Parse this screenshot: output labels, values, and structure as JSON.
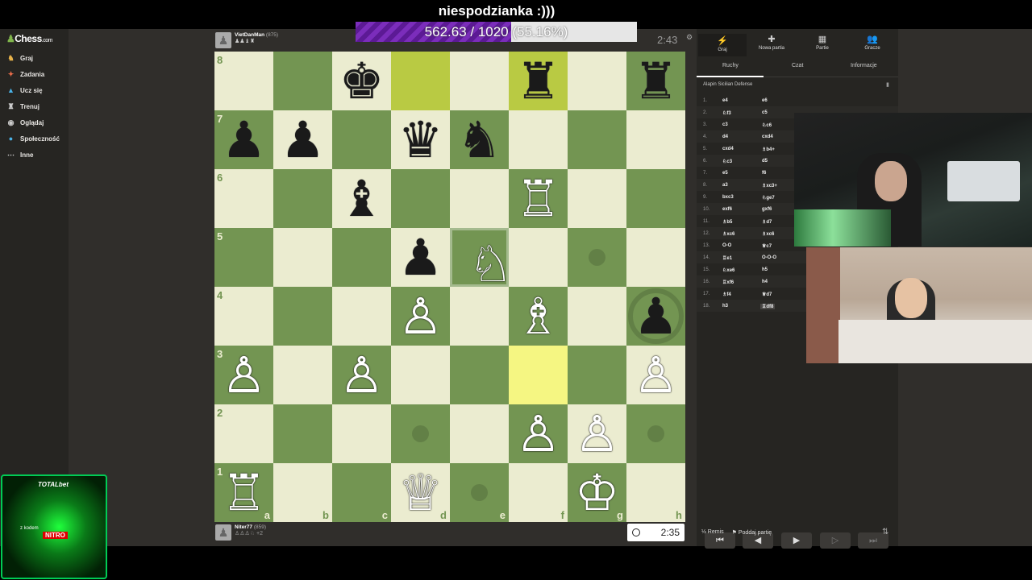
{
  "stream": {
    "alert_title": "niespodzianka :)))",
    "progress_text": "562.63 / 1020 (55.16%)",
    "progress_fraction": 0.5516
  },
  "sidebar": {
    "logo_text": "Chess",
    "logo_suffix": ".com",
    "items": [
      {
        "label": "Graj",
        "icon": "play-icon"
      },
      {
        "label": "Zadania",
        "icon": "puzzle-icon"
      },
      {
        "label": "Ucz się",
        "icon": "learn-icon"
      },
      {
        "label": "Trenuj",
        "icon": "train-icon"
      },
      {
        "label": "Oglądaj",
        "icon": "watch-icon"
      },
      {
        "label": "Społeczność",
        "icon": "community-icon"
      },
      {
        "label": "Inne",
        "icon": "more-icon"
      }
    ]
  },
  "top_player": {
    "name": "VietDanMan",
    "rating": "(875)",
    "clock": "2:43"
  },
  "bottom_player": {
    "name": "Niter77",
    "rating": "(859)",
    "clock": "2:35"
  },
  "board": {
    "files": [
      "a",
      "b",
      "c",
      "d",
      "e",
      "f",
      "g",
      "h"
    ],
    "ranks": [
      "8",
      "7",
      "6",
      "5",
      "4",
      "3",
      "2",
      "1"
    ],
    "highlight_last_move": "#b9ca43",
    "highlight_target": "#f5f682",
    "light_color": "#ebecd0",
    "dark_color": "#739552",
    "pieces": [
      {
        "sq": "c8",
        "p": "♚",
        "c": "b"
      },
      {
        "sq": "f8",
        "p": "♜",
        "c": "b"
      },
      {
        "sq": "h8",
        "p": "♜",
        "c": "b"
      },
      {
        "sq": "a7",
        "p": "♟",
        "c": "b"
      },
      {
        "sq": "b7",
        "p": "♟",
        "c": "b"
      },
      {
        "sq": "d7",
        "p": "♛",
        "c": "b"
      },
      {
        "sq": "e7",
        "p": "♞",
        "c": "b"
      },
      {
        "sq": "c6",
        "p": "♝",
        "c": "b"
      },
      {
        "sq": "f6",
        "p": "♖",
        "c": "w"
      },
      {
        "sq": "d5",
        "p": "♟",
        "c": "b"
      },
      {
        "sq": "e5",
        "p": "♘",
        "c": "w"
      },
      {
        "sq": "d4",
        "p": "♙",
        "c": "w"
      },
      {
        "sq": "f4",
        "p": "♗",
        "c": "w"
      },
      {
        "sq": "h4",
        "p": "♟",
        "c": "b"
      },
      {
        "sq": "a3",
        "p": "♙",
        "c": "w"
      },
      {
        "sq": "c3",
        "p": "♙",
        "c": "w"
      },
      {
        "sq": "h3",
        "p": "♙",
        "c": "w"
      },
      {
        "sq": "f2",
        "p": "♙",
        "c": "w"
      },
      {
        "sq": "g2",
        "p": "♙",
        "c": "w"
      },
      {
        "sq": "a1",
        "p": "♖",
        "c": "w"
      },
      {
        "sq": "d1",
        "p": "♕",
        "c": "w"
      },
      {
        "sq": "g1",
        "p": "♔",
        "c": "w"
      }
    ],
    "highlights": [
      "d8",
      "f8"
    ],
    "target_squares": [
      "f3"
    ],
    "move_dots": [
      "g5",
      "d2",
      "h2",
      "e1"
    ],
    "capture_rings": [
      "h4"
    ],
    "selected": "e5"
  },
  "panel": {
    "tabs": [
      {
        "label": "Graj",
        "icon": "⚡"
      },
      {
        "label": "Nowa partia",
        "icon": "✚"
      },
      {
        "label": "Partie",
        "icon": "▦"
      },
      {
        "label": "Gracze",
        "icon": "👥"
      }
    ],
    "subtabs": [
      "Ruchy",
      "Czat",
      "Informacje"
    ],
    "opening": "Alapin Sicilian Defense",
    "moves": [
      {
        "n": "1.",
        "w": "e4",
        "b": "e6"
      },
      {
        "n": "2.",
        "w": "♘f3",
        "b": "c5"
      },
      {
        "n": "3.",
        "w": "c3",
        "b": "♘c6"
      },
      {
        "n": "4.",
        "w": "d4",
        "b": "cxd4"
      },
      {
        "n": "5.",
        "w": "cxd4",
        "b": "♗b4+"
      },
      {
        "n": "6.",
        "w": "♘c3",
        "b": "d5"
      },
      {
        "n": "7.",
        "w": "e5",
        "b": "f6"
      },
      {
        "n": "8.",
        "w": "a3",
        "b": "♗xc3+"
      },
      {
        "n": "9.",
        "w": "bxc3",
        "b": "♘ge7"
      },
      {
        "n": "10.",
        "w": "exf6",
        "b": "gxf6"
      },
      {
        "n": "11.",
        "w": "♗b5",
        "b": "♗d7"
      },
      {
        "n": "12.",
        "w": "♗xc6",
        "b": "♗xc6"
      },
      {
        "n": "13.",
        "w": "O-O",
        "b": "♕c7"
      },
      {
        "n": "14.",
        "w": "♖e1",
        "b": "O-O-O"
      },
      {
        "n": "15.",
        "w": "♘xe6",
        "b": "h5"
      },
      {
        "n": "16.",
        "w": "♖xf6",
        "b": "h4"
      },
      {
        "n": "17.",
        "w": "♗f4",
        "b": "♕d7"
      },
      {
        "n": "18.",
        "w": "h3",
        "b": "♖df8"
      }
    ],
    "nav": [
      "⏮",
      "◀",
      "▶",
      "▷",
      "⏭"
    ],
    "draw_label": "Remis",
    "draw_prefix": "½",
    "resign_label": "Poddaj partię"
  },
  "ad": {
    "brand": "TOTALbet",
    "code_label": "z kodem",
    "code": "NITRO"
  }
}
